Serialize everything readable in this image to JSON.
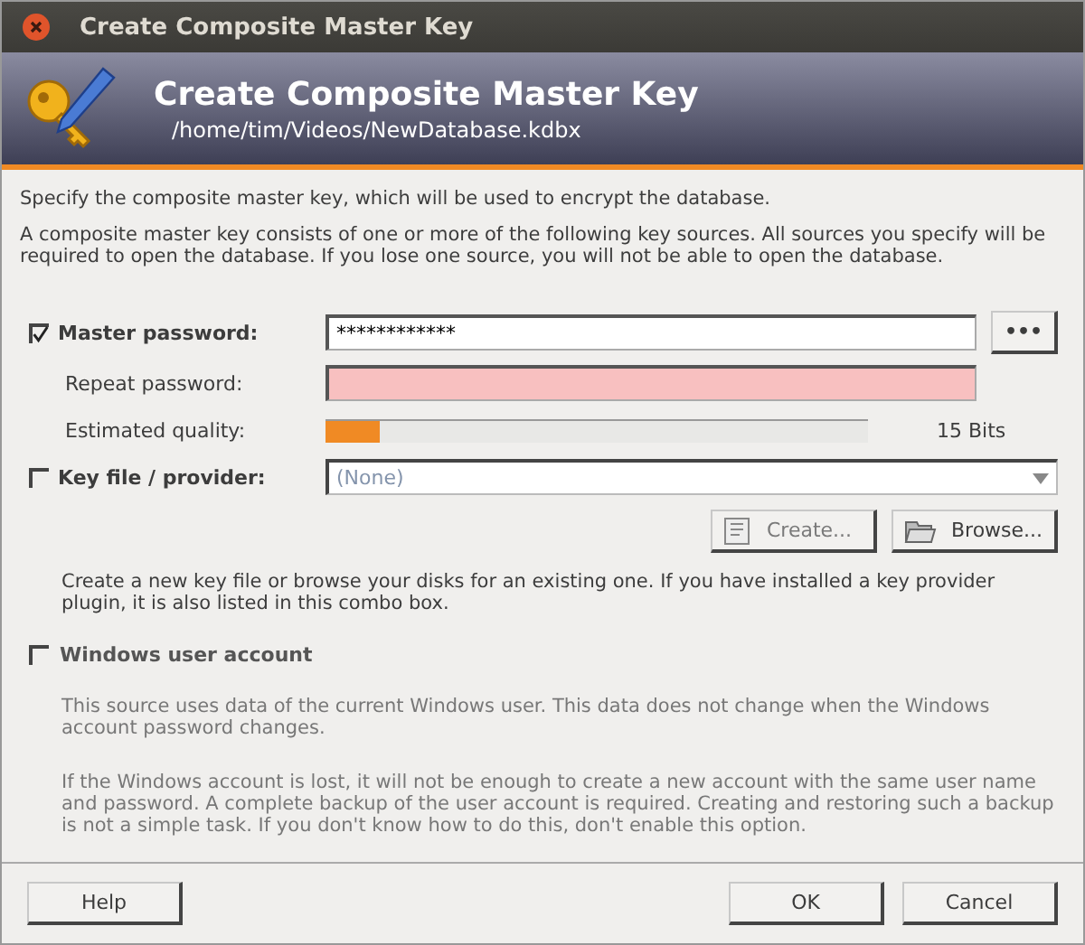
{
  "window": {
    "title": "Create Composite Master Key"
  },
  "header": {
    "title": "Create Composite Master Key",
    "path": "/home/tim/Videos/NewDatabase.kdbx"
  },
  "intro": [
    "Specify the composite master key, which will be used to encrypt the database.",
    "A composite master key consists of one or more of the following key sources. All sources you specify will be required to open the database.  If you lose one source, you will not be able to open the database."
  ],
  "master_password": {
    "label": "Master password:",
    "checked": true,
    "value": "************",
    "toggle": "•••"
  },
  "repeat_password": {
    "label": "Repeat password:",
    "invalid": true
  },
  "quality": {
    "label": "Estimated quality:",
    "level": 0.1,
    "reading": "15 Bits"
  },
  "key_file": {
    "label": "Key file / provider:",
    "checked": false,
    "value": "(None)",
    "disabled": true,
    "create": {
      "label": "Create...",
      "disabled": true
    },
    "browse": {
      "label": "Browse...",
      "disabled": false
    },
    "note": "Create a new key file or browse your disks for an existing one. If you have installed a key provider plugin, it is also listed in this combo box."
  },
  "windows_account": {
    "label": "Windows user account",
    "checked": false,
    "disabled": true,
    "notes": [
      "This source uses data of the current Windows user. This data does not change when the Windows account password changes.",
      "If the Windows account is lost, it will not be enough to create a new account with the same user name and password. A complete backup of the user account is required. Creating and restoring such a backup is not a simple task. If you don't know how to do this, don't enable this option."
    ]
  },
  "buttons": [
    {
      "label": "Help"
    },
    {
      "label": "OK"
    },
    {
      "label": "Cancel"
    }
  ]
}
